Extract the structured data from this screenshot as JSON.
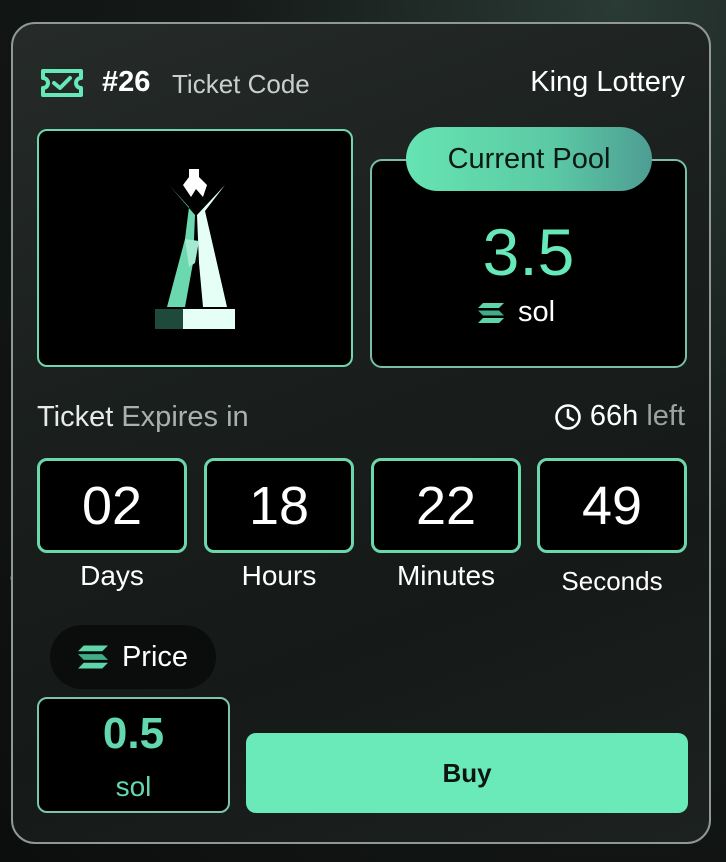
{
  "header": {
    "ticket_number": "#26",
    "ticket_code_label": "Ticket Code",
    "lottery_name": "King Lottery"
  },
  "pool": {
    "label": "Current Pool",
    "value": "3.5",
    "unit": "sol"
  },
  "expiry": {
    "label_part1": "Ticket",
    "label_part2": "Expires in",
    "hours_left": "66h",
    "left_word": "left"
  },
  "countdown": [
    {
      "value": "02",
      "label": "Days"
    },
    {
      "value": "18",
      "label": "Hours"
    },
    {
      "value": "22",
      "label": "Minutes"
    },
    {
      "value": "49",
      "label": "Seconds"
    }
  ],
  "price": {
    "label": "Price",
    "value": "0.5",
    "unit": "sol"
  },
  "buy_label": "Buy",
  "colors": {
    "accent": "#6aeab8",
    "accent_text": "#67e8b8",
    "card_border": "#8f9896"
  }
}
